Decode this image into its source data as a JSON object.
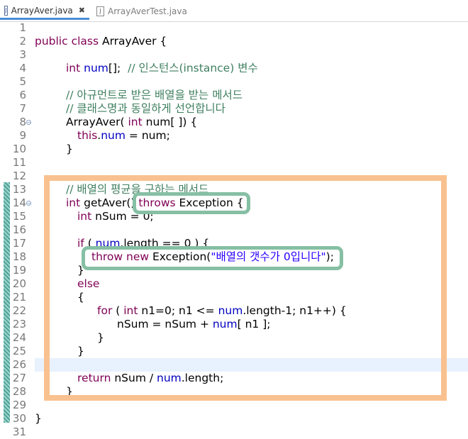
{
  "tabs": [
    {
      "label": "ArrayAver.java",
      "close": "✖",
      "active": true
    },
    {
      "label": "ArrayAverTest.java",
      "active": false
    }
  ],
  "line_numbers": [
    "1",
    "2",
    "3",
    "4",
    "5",
    "6",
    "7",
    "8",
    "9",
    "10",
    "11",
    "12",
    "13",
    "14",
    "15",
    "16",
    "17",
    "18",
    "19",
    "20",
    "21",
    "22",
    "23",
    "24",
    "25",
    "26",
    "27",
    "28",
    "29",
    "30",
    "31"
  ],
  "code": {
    "l2": {
      "kw": "public class",
      "rest": " ArrayAver {"
    },
    "l4": {
      "kw": "int",
      "fld": "num",
      "rest": "[];",
      "cmt": "// 인스턴스(instance) 변수"
    },
    "l6": {
      "cmt": "// 아규먼트로 받은 배열을 받는 메서드"
    },
    "l7": {
      "cmt": "// 클래스명과 동일하게 선언합니다"
    },
    "l8": {
      "a": "ArrayAver( ",
      "kw": "int",
      "rest": " num[ ]) {"
    },
    "l9": {
      "kw": "this",
      "dot": ".",
      "fld": "num",
      "rest": " = num;"
    },
    "l10": {
      "text": "}"
    },
    "l13": {
      "cmt": "// 배열의 평균을 구하는 메서드"
    },
    "l14": {
      "kw": "int",
      "a": " getAver() ",
      "kw2": "throws",
      "rest": " Exception {"
    },
    "l15": {
      "kw": "int",
      "rest": " nSum = 0;"
    },
    "l17": {
      "kw": "if",
      "a": " ( ",
      "fld": "num",
      "rest": ".length == 0 ) {"
    },
    "l18": {
      "kw": "throw new",
      "a": " Exception(",
      "str": "\"배열의 갯수가 0입니다\"",
      "rest": ");"
    },
    "l19": {
      "text": "}"
    },
    "l20": {
      "kw": "else"
    },
    "l21": {
      "text": "{"
    },
    "l22": {
      "kw": "for",
      "a": " ( ",
      "kw2": "int",
      "b": " n1=0; n1 <= ",
      "fld": "num",
      "rest": ".length-1; n1++) {"
    },
    "l23": {
      "a": "nSum = nSum + ",
      "fld": "num",
      "rest": "[ n1 ];"
    },
    "l24": {
      "text": "}"
    },
    "l25": {
      "text": "}"
    },
    "l27": {
      "kw": "return",
      "a": " nSum / ",
      "fld": "num",
      "rest": ".length;"
    },
    "l28": {
      "text": "}"
    },
    "l30": {
      "text": "}"
    }
  },
  "colors": {
    "keyword": "#7f0055",
    "field": "#0000c0",
    "comment": "#3f7f5f",
    "string": "#2a00ff",
    "highlight_orange": "#f9c18f",
    "highlight_green": "#86bfa4",
    "current_line": "#e8f2fe"
  }
}
